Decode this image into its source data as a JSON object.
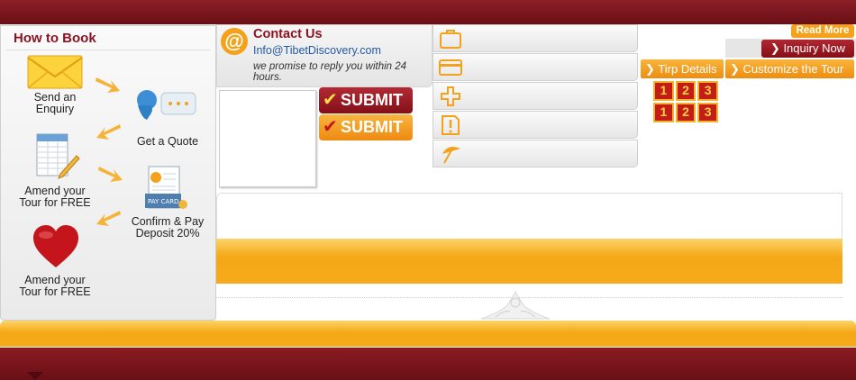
{
  "how_to_book": {
    "title": "How to Book",
    "steps": [
      "Send an Enquiry",
      "Get a Quote",
      "Amend your Tour for FREE",
      "Confirm & Pay Deposit 20%",
      "Amend your Tour for FREE"
    ],
    "pay_card_label": "PAY CARD"
  },
  "contact": {
    "title": "Contact Us",
    "email": "Info@TibetDiscovery.com",
    "note": "we promise to reply you within 24 hours.",
    "icon": "at-icon"
  },
  "buttons": {
    "submit_1": "SUBMIT",
    "submit_2": "SUBMIT",
    "read_more": "Read More",
    "inquiry_now": "Inquiry Now",
    "tirp_details": "Tirp Details",
    "customize_tour": "Customize the Tour"
  },
  "icon_rows": [
    "suitcase-icon",
    "credit-card-icon",
    "medical-cross-icon",
    "alert-icon",
    "umbrella-icon"
  ],
  "number_rows": [
    [
      "1",
      "2",
      "3"
    ],
    [
      "1",
      "2",
      "3"
    ]
  ],
  "colors": {
    "maroon": "#7a141c",
    "orange": "#f5a21a",
    "link_blue": "#2358a8"
  }
}
